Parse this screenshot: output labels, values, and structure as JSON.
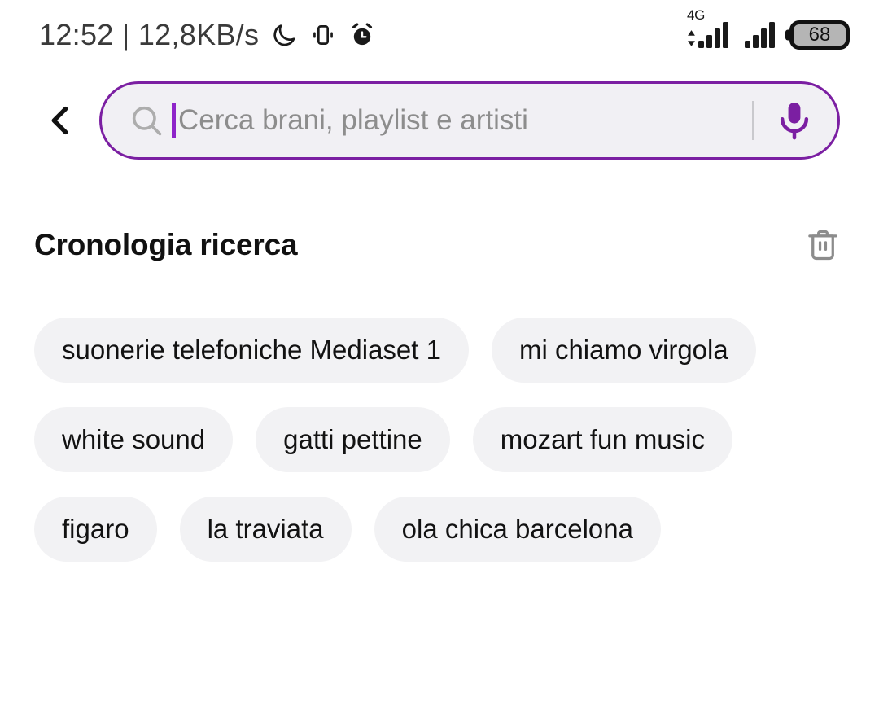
{
  "status_bar": {
    "clock": "12:52 | 12,8KB/s",
    "icons": [
      "moon-dnd-icon",
      "vibrate-icon",
      "alarm-icon"
    ],
    "network_label": "4G",
    "battery_level": "68"
  },
  "header": {
    "back_label": "chevron-left-icon",
    "search": {
      "placeholder": "Cerca brani, playlist e artisti",
      "value": "",
      "search_icon": "search-icon",
      "mic_icon": "microphone-icon"
    }
  },
  "history": {
    "title": "Cronologia ricerca",
    "clear_icon": "trash-icon",
    "items": [
      "suonerie telefoniche Mediaset 1",
      "mi chiamo virgola",
      "white sound",
      "gatti pettine",
      "mozart fun music",
      "figaro",
      "la traviata",
      "ola chica barcelona"
    ]
  },
  "colors": {
    "accent": "#7b1fa2",
    "caret": "#8e24c9",
    "field_bg": "#f1f0f4",
    "chip_bg": "#f2f2f4",
    "page_bg": "#ffffff",
    "placeholder": "#8d8d8d"
  }
}
